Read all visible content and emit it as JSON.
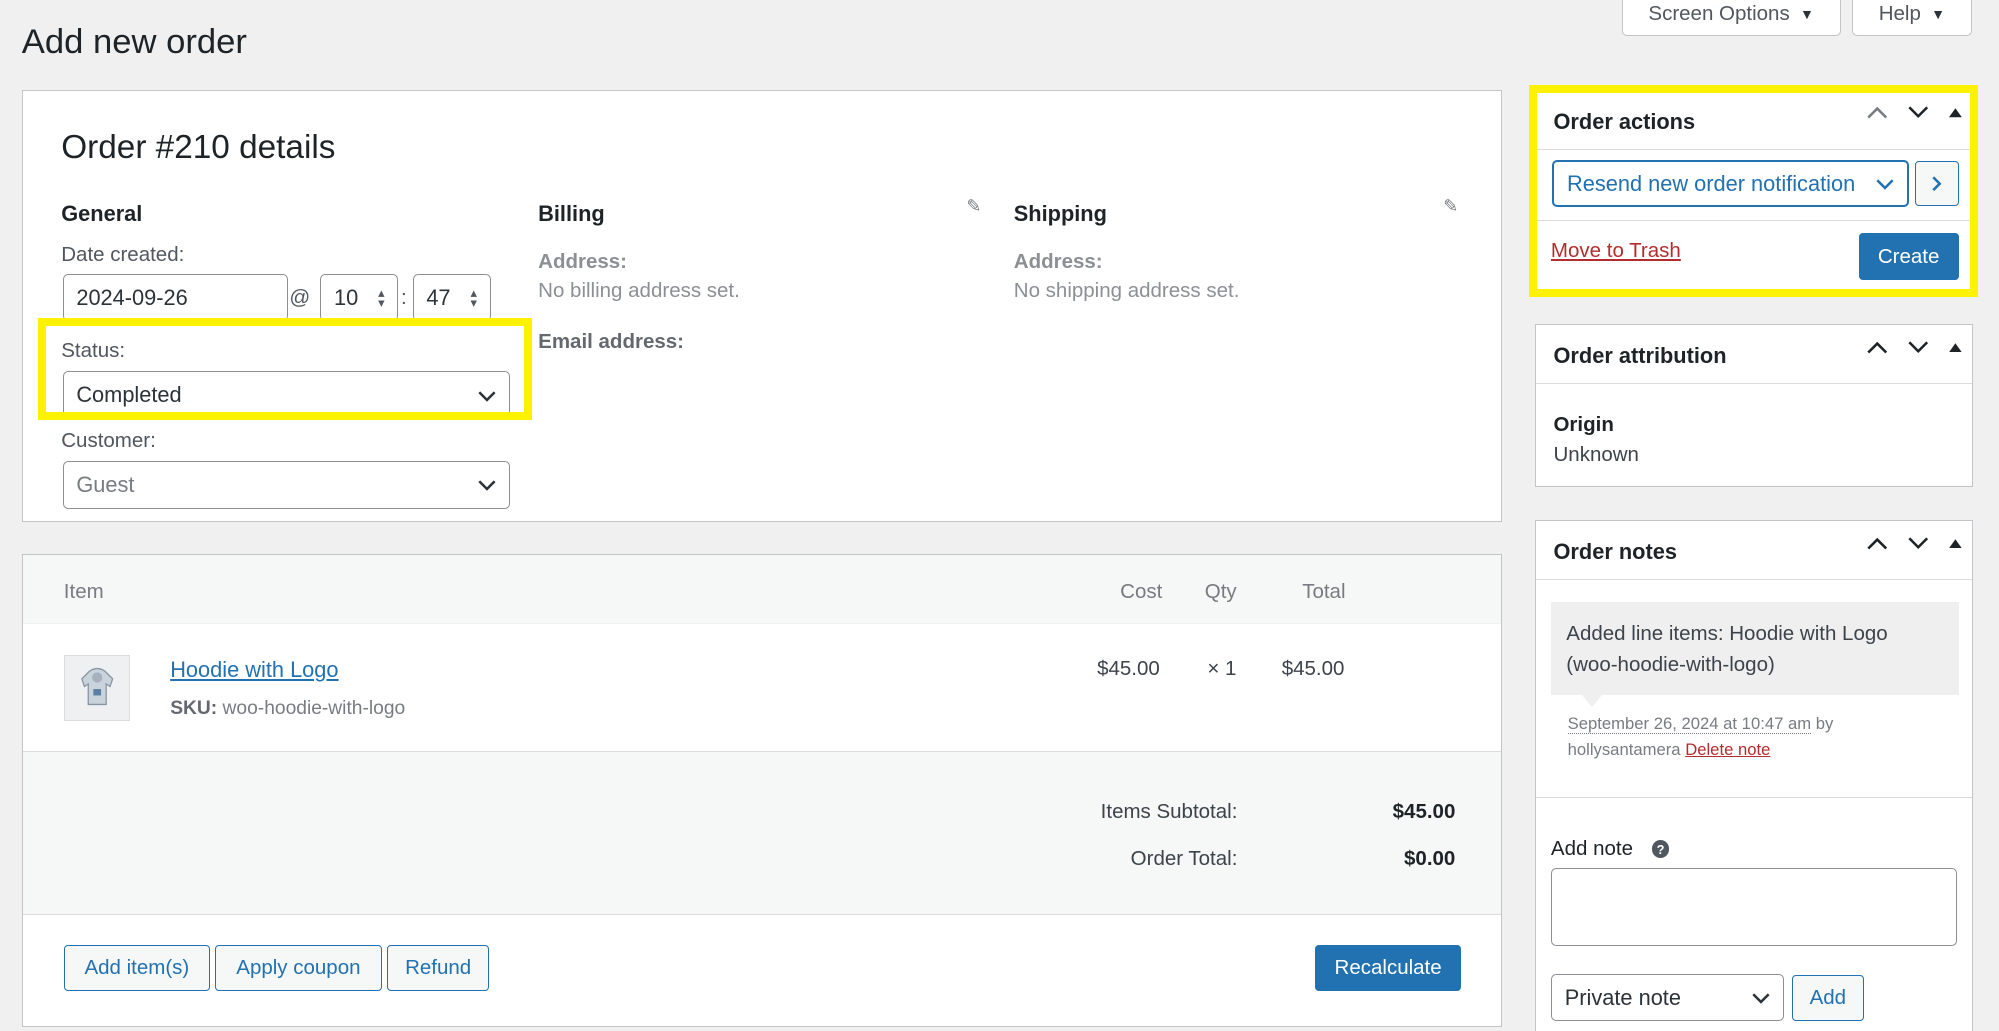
{
  "header": {
    "title": "Add new order",
    "screen_options": "Screen Options",
    "help": "Help"
  },
  "order": {
    "heading": "Order #210 details",
    "general": {
      "heading": "General",
      "date_label": "Date created:",
      "date": "2024-09-26",
      "at": "@",
      "hour": "10",
      "colon": ":",
      "minute": "47",
      "status_label": "Status:",
      "status": "Completed",
      "customer_label": "Customer:",
      "customer": "Guest"
    },
    "billing": {
      "heading": "Billing",
      "address_label": "Address:",
      "address": "No billing address set.",
      "email_label": "Email address:"
    },
    "shipping": {
      "heading": "Shipping",
      "address_label": "Address:",
      "address": "No shipping address set."
    }
  },
  "items": {
    "columns": {
      "item": "Item",
      "cost": "Cost",
      "qty": "Qty",
      "total": "Total"
    },
    "rows": [
      {
        "name": "Hoodie with Logo",
        "sku_label": "SKU:",
        "sku": "woo-hoodie-with-logo",
        "cost": "$45.00",
        "qty": "× 1",
        "total": "$45.00"
      }
    ],
    "subtotal_label": "Items Subtotal:",
    "subtotal": "$45.00",
    "order_total_label": "Order Total:",
    "order_total": "$0.00",
    "buttons": {
      "add_items": "Add item(s)",
      "apply_coupon": "Apply coupon",
      "refund": "Refund",
      "recalculate": "Recalculate"
    }
  },
  "order_actions": {
    "title": "Order actions",
    "selected_action": "Resend new order notification",
    "trash": "Move to Trash",
    "create": "Create"
  },
  "order_attribution": {
    "title": "Order attribution",
    "origin_label": "Origin",
    "origin": "Unknown"
  },
  "order_notes": {
    "title": "Order notes",
    "note_text": "Added line items: Hoodie with Logo (woo-hoodie-with-logo)",
    "note_date": "September 26, 2024 at 10:47 am",
    "note_by": "by",
    "note_author": "hollysantamera",
    "delete_note": "Delete note",
    "add_note_label": "Add note",
    "note_type": "Private note",
    "add_button": "Add"
  },
  "colors": {
    "primary": "#2271b1",
    "highlight": "#fff200",
    "danger": "#b32d2e",
    "background": "#f0f0f1"
  }
}
